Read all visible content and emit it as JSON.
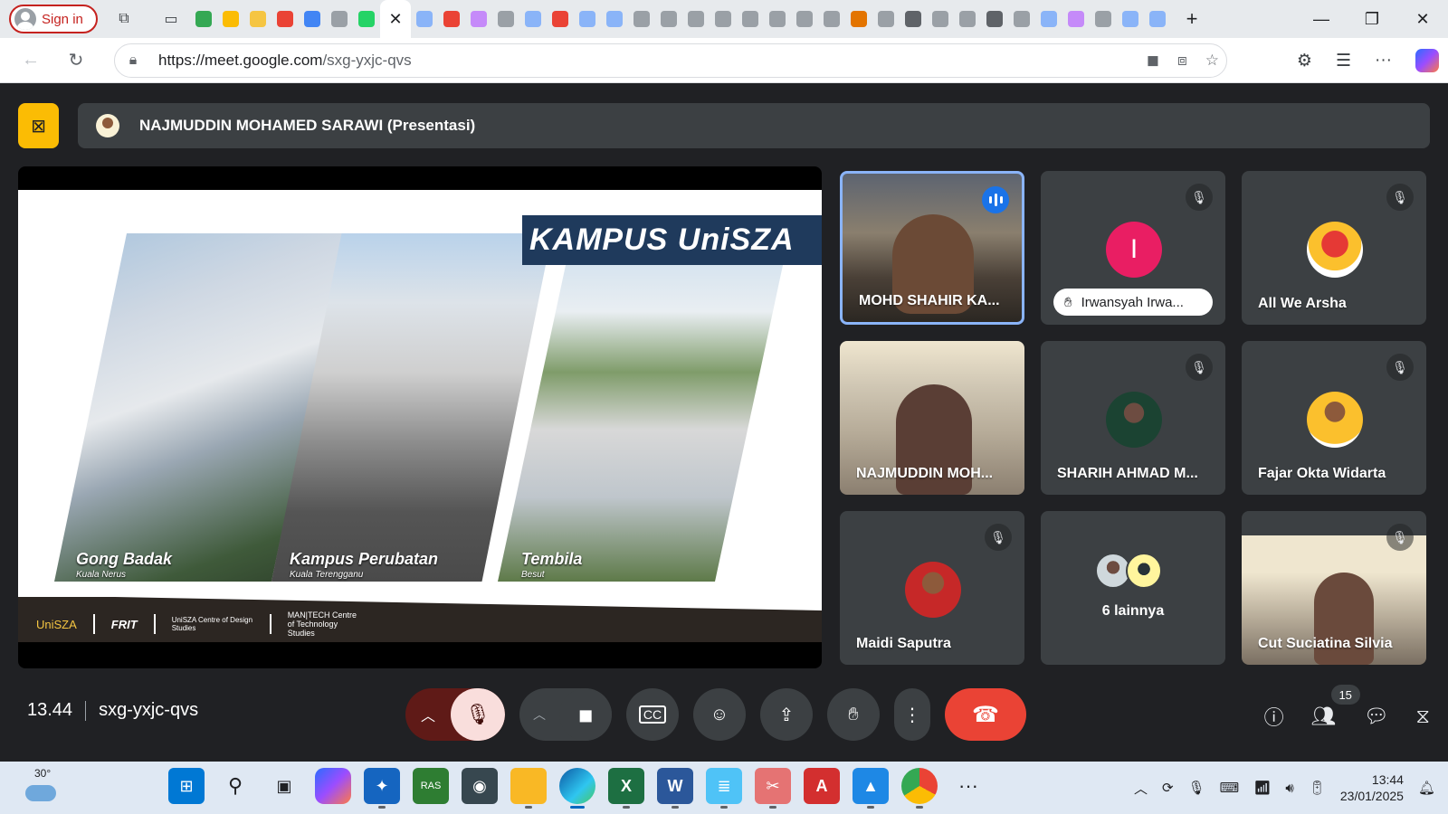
{
  "browser": {
    "signin_label": "Sign in",
    "url_host": "https://meet.google.com",
    "url_path": "/sxg-yxjc-qvs",
    "tab_colors": [
      "#34a853",
      "#fbbc04",
      "#f5c542",
      "#ea4335",
      "#4285f4",
      "#9aa0a6",
      "#25d366",
      "#ffffff",
      "#8ab4f8",
      "#ea4335",
      "#c58af9",
      "#9aa0a6",
      "#8ab4f8",
      "#ea4335",
      "#8ab4f8",
      "#8ab4f8",
      "#9aa0a6",
      "#9aa0a6",
      "#9aa0a6",
      "#9aa0a6",
      "#9aa0a6",
      "#9aa0a6",
      "#9aa0a6",
      "#9aa0a6",
      "#e37400",
      "#9aa0a6",
      "#5f6368",
      "#9aa0a6",
      "#9aa0a6",
      "#5f6368",
      "#9aa0a6",
      "#8ab4f8",
      "#c58af9",
      "#9aa0a6",
      "#8ab4f8",
      "#8ab4f8"
    ]
  },
  "meet": {
    "presenter_bar": "NAJMUDDIN MOHAMED SARAWI (Presentasi)",
    "slide": {
      "title": "KAMPUS UniSZA",
      "photos": [
        {
          "caption": "Gong Badak",
          "sub": "Kuala Nerus"
        },
        {
          "caption": "Kampus Perubatan",
          "sub": "Kuala Terengganu"
        },
        {
          "caption": "Tembila",
          "sub": "Besut"
        }
      ],
      "footer_logos": [
        "UniSZA",
        "FRIT",
        "UniSZA Centre of Design Studies",
        "MAN|TECH Centre of Technology Studies"
      ]
    },
    "participants": [
      {
        "name": "MOHD SHAHIR KA...",
        "type": "video",
        "speaking": true
      },
      {
        "name": "Irwansyah Irwa...",
        "type": "letter",
        "letter": "I",
        "hand": true,
        "muted": true
      },
      {
        "name": "All We Arsha",
        "type": "avatar",
        "muted": true
      },
      {
        "name": "NAJMUDDIN MOH...",
        "type": "video"
      },
      {
        "name": "SHARIH AHMAD M...",
        "type": "avatar",
        "muted": true
      },
      {
        "name": "Fajar Okta Widarta",
        "type": "avatar",
        "muted": true
      },
      {
        "name": "Maidi Saputra",
        "type": "avatar",
        "muted": true
      },
      {
        "name": "6 lainnya",
        "type": "more"
      },
      {
        "name": "Cut Suciatina Silvia",
        "type": "video",
        "muted": true
      }
    ],
    "time": "13.44",
    "meeting_code": "sxg-yxjc-qvs",
    "people_count": "15"
  },
  "taskbar": {
    "weather_temp": "30°",
    "clock_time": "13:44",
    "clock_date": "23/01/2025"
  }
}
